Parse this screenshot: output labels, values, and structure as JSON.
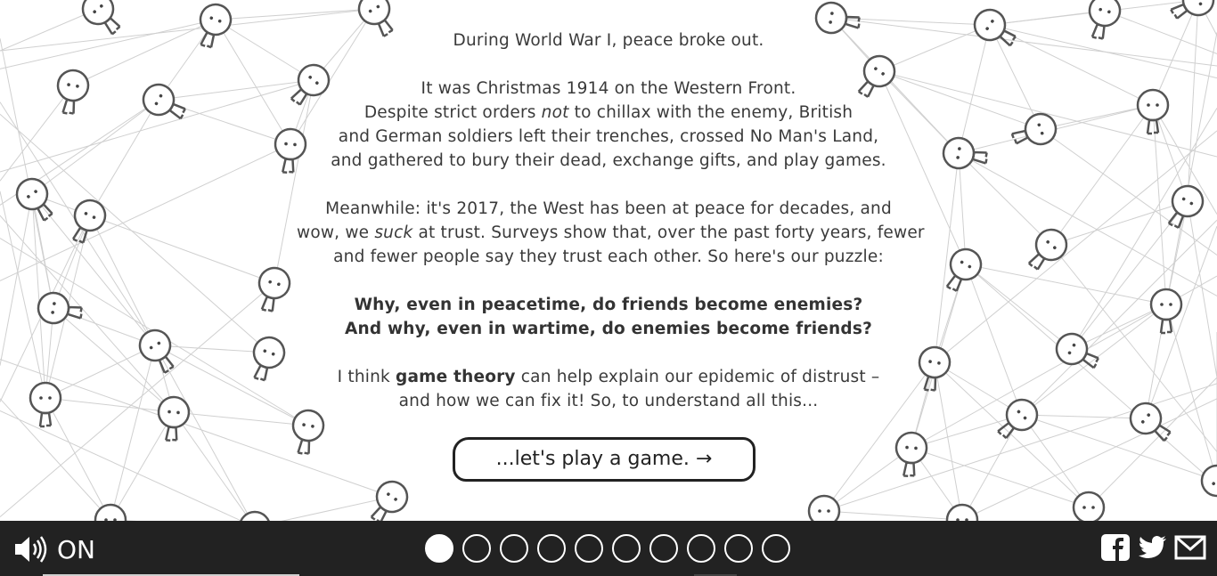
{
  "intro": {
    "line1": "During World War I, peace broke out.",
    "para2": {
      "line1": "It was Christmas 1914 on the Western Front.",
      "line2_a": "Despite strict orders ",
      "line2_em": "not",
      "line2_b": " to chillax with the enemy, British",
      "line3": "and German soldiers left their trenches, crossed No Man's Land,",
      "line4": "and gathered to bury their dead, exchange gifts, and play games."
    },
    "para3": {
      "line1": "Meanwhile: it's 2017, the West has been at peace for decades, and",
      "line2_a": "wow, we ",
      "line2_em": "suck",
      "line2_b": " at trust. Surveys show that, over the past forty years, fewer",
      "line3": "and fewer people say they trust each other. So here's our puzzle:"
    },
    "question1": "Why, even in peacetime, do friends become enemies?",
    "question2": "And why, even in wartime, do enemies become friends?",
    "para5": {
      "line1_a": "I think ",
      "line1_b": "game theory",
      "line1_c": " can help explain our epidemic of distrust –",
      "line2": "and how we can fix it! So, to understand all this..."
    }
  },
  "play_button": "...let's play a game. →",
  "footer": {
    "sound_label": "ON",
    "sound_icon": "speaker-icon",
    "chapters": [
      {
        "active": true
      },
      {
        "active": false
      },
      {
        "active": false
      },
      {
        "active": false
      },
      {
        "active": false
      },
      {
        "active": false
      },
      {
        "active": false
      },
      {
        "active": false
      },
      {
        "active": false
      },
      {
        "active": false
      }
    ],
    "share_icons": [
      "facebook-icon",
      "twitter-icon",
      "email-icon"
    ]
  },
  "colors": {
    "footer_bg": "#222222",
    "network_line": "#d0d0d0",
    "character_stroke": "#555555"
  }
}
